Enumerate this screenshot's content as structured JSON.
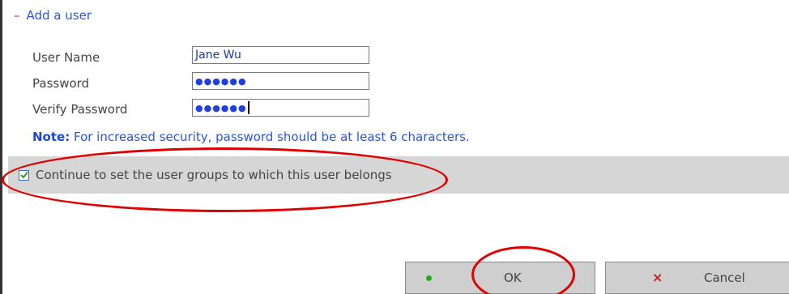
{
  "section": {
    "collapse_symbol": "–",
    "title": "Add a user"
  },
  "form": {
    "username": {
      "label": "User Name",
      "value": "Jane Wu"
    },
    "password": {
      "label": "Password",
      "masked_value": "●●●●●●"
    },
    "verify_password": {
      "label": "Verify Password",
      "masked_value": "●●●●●●"
    }
  },
  "note": {
    "label": "Note:",
    "text": " For increased security, password should be at least 6 characters."
  },
  "groups_option": {
    "checked": true,
    "label": "Continue to set the user groups to which this user belongs"
  },
  "buttons": {
    "ok": {
      "label": "OK",
      "icon": "green-dot-icon"
    },
    "cancel": {
      "label": "Cancel",
      "icon": "red-x-icon",
      "icon_glyph": "×"
    }
  },
  "colors": {
    "accent": "#2a56d6",
    "highlight_annotation": "#e00000",
    "band": "#d6d6d6",
    "ok_icon": "#22aa22",
    "cancel_icon": "#c51f1f"
  }
}
